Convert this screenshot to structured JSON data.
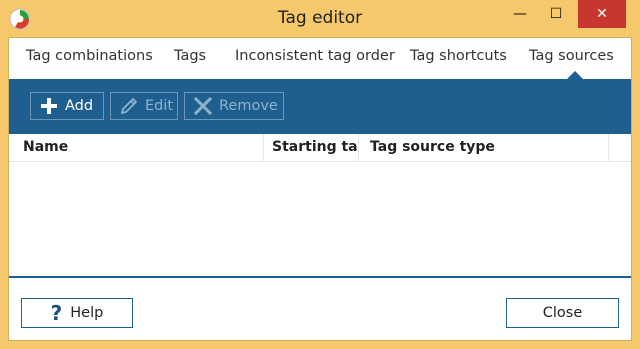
{
  "window": {
    "title": "Tag editor",
    "controls": {
      "minimize": "—",
      "maximize": "☐",
      "close": "✕"
    }
  },
  "tabs": [
    {
      "label": "Tag combinations",
      "selected": false
    },
    {
      "label": "Tags",
      "selected": false
    },
    {
      "label": "Inconsistent tag order",
      "selected": false
    },
    {
      "label": "Tag shortcuts",
      "selected": false
    },
    {
      "label": "Tag sources",
      "selected": true
    }
  ],
  "toolbar": {
    "add_label": "Add",
    "edit_label": "Edit",
    "remove_label": "Remove",
    "add_enabled": true,
    "edit_enabled": false,
    "remove_enabled": false
  },
  "table": {
    "columns": [
      "Name",
      "Starting tags",
      "Tag source type"
    ],
    "rows": []
  },
  "footer": {
    "help_label": "Help",
    "close_label": "Close"
  },
  "colors": {
    "frame": "#f5c96b",
    "accent": "#1f5f8f",
    "close_button": "#c7372f"
  }
}
